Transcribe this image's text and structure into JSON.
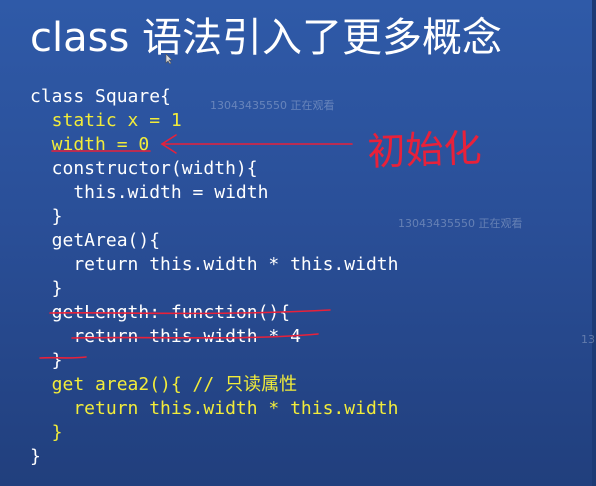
{
  "slide": {
    "title": "class 语法引入了更多概念",
    "code_lines": [
      "class Square{",
      "  static x = 1",
      "  width = 0",
      "  constructor(width){",
      "    this.width = width",
      "  }",
      "  getArea(){",
      "    return this.width * this.width",
      "  }",
      "  getLength: function(){",
      "    return this.width * 4",
      "  }",
      "  get area2(){ // 只读属性",
      "    return this.width * this.width",
      "  }",
      "}"
    ],
    "annotation_text": "初始化",
    "colors": {
      "highlight": "#f2ec3a",
      "code": "#ffffff",
      "annotation": "#e8213a"
    }
  },
  "watermarks": [
    "13043435550 正在观看",
    "13043435550 正在观看",
    "13"
  ]
}
